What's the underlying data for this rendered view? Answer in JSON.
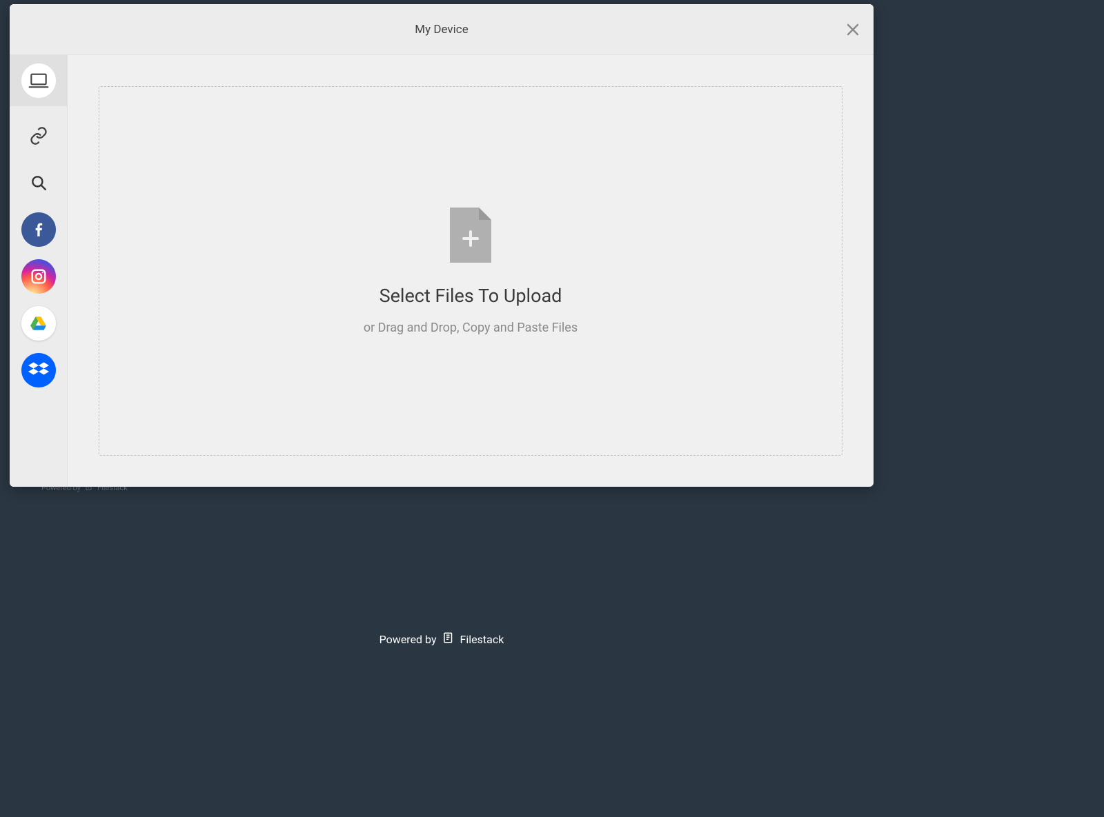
{
  "header": {
    "title": "My Device"
  },
  "sidebar": {
    "sources": [
      {
        "id": "my-device",
        "label": "My Device",
        "active": true
      },
      {
        "id": "link",
        "label": "Link (URL)"
      },
      {
        "id": "search",
        "label": "Web Search"
      },
      {
        "id": "facebook",
        "label": "Facebook"
      },
      {
        "id": "instagram",
        "label": "Instagram"
      },
      {
        "id": "googledrive",
        "label": "Google Drive"
      },
      {
        "id": "dropbox",
        "label": "Dropbox"
      }
    ]
  },
  "dropzone": {
    "primary": "Select Files To Upload",
    "secondary": "or Drag and Drop, Copy and Paste Files"
  },
  "footer": {
    "powered_by": "Powered by",
    "brand": "Filestack"
  },
  "background": {
    "powered_by": "Powered by",
    "brand": "Filestack"
  }
}
